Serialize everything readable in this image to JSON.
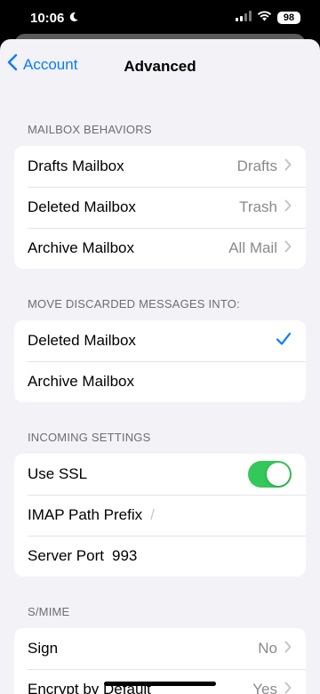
{
  "status": {
    "time": "10:06",
    "battery": "98"
  },
  "nav": {
    "back_label": "Account",
    "title": "Advanced"
  },
  "mailbox_behaviors": {
    "header": "MAILBOX BEHAVIORS",
    "rows": [
      {
        "label": "Drafts Mailbox",
        "value": "Drafts"
      },
      {
        "label": "Deleted Mailbox",
        "value": "Trash"
      },
      {
        "label": "Archive Mailbox",
        "value": "All Mail"
      }
    ]
  },
  "move_discarded": {
    "header": "MOVE DISCARDED MESSAGES INTO:",
    "rows": [
      {
        "label": "Deleted Mailbox",
        "selected": true
      },
      {
        "label": "Archive Mailbox",
        "selected": false
      }
    ]
  },
  "incoming": {
    "header": "INCOMING SETTINGS",
    "use_ssl_label": "Use SSL",
    "use_ssl_on": true,
    "imap_label": "IMAP Path Prefix",
    "imap_placeholder": "/",
    "port_label": "Server Port",
    "port_value": "993"
  },
  "smime": {
    "header": "S/MIME",
    "rows": [
      {
        "label": "Sign",
        "value": "No"
      },
      {
        "label": "Encrypt by Default",
        "value": "Yes"
      }
    ]
  },
  "colors": {
    "accent": "#0a7aff",
    "toggle_on": "#34c759",
    "background": "#f2f2f7"
  }
}
